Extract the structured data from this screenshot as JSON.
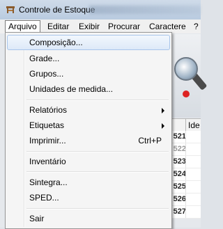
{
  "window": {
    "title": "Controle de Estoque"
  },
  "menubar": {
    "items": [
      {
        "label": "Arquivo"
      },
      {
        "label": "Editar"
      },
      {
        "label": "Exibir"
      },
      {
        "label": "Procurar"
      },
      {
        "label": "Caractere"
      },
      {
        "label": "?"
      }
    ]
  },
  "menu": {
    "items": [
      {
        "label": "Composição..."
      },
      {
        "label": "Grade..."
      },
      {
        "label": "Grupos..."
      },
      {
        "label": "Unidades de medida..."
      },
      {
        "label": "Relatórios"
      },
      {
        "label": "Etiquetas"
      },
      {
        "label": "Imprimir...",
        "shortcut": "Ctrl+P"
      },
      {
        "label": "Inventário"
      },
      {
        "label": "Sintegra..."
      },
      {
        "label": "SPED..."
      },
      {
        "label": "Sair"
      }
    ]
  },
  "grid": {
    "header": "Ide",
    "rows": [
      "521",
      "522",
      "523",
      "524",
      "525",
      "526",
      "527"
    ]
  },
  "colors": {
    "highlight": "#dde9f8",
    "menu_bg": "#f5f5f5"
  }
}
